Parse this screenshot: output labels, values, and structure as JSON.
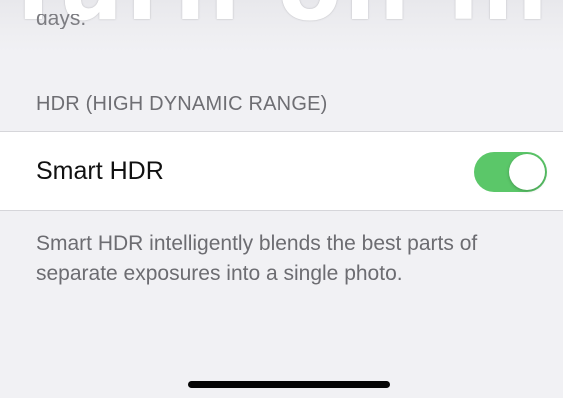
{
  "overlay": {
    "title_fragment": "Turn on in Setti"
  },
  "prior_section": {
    "footer_fragment": "days."
  },
  "hdr_section": {
    "header": "HDR (HIGH DYNAMIC RANGE)",
    "smart_hdr": {
      "label": "Smart HDR",
      "enabled": true
    },
    "footer": "Smart HDR intelligently blends the best parts of separate exposures into a single photo."
  },
  "colors": {
    "toggle_on": "#5bc769",
    "background": "#f1f1f4",
    "cell_background": "#ffffff"
  }
}
